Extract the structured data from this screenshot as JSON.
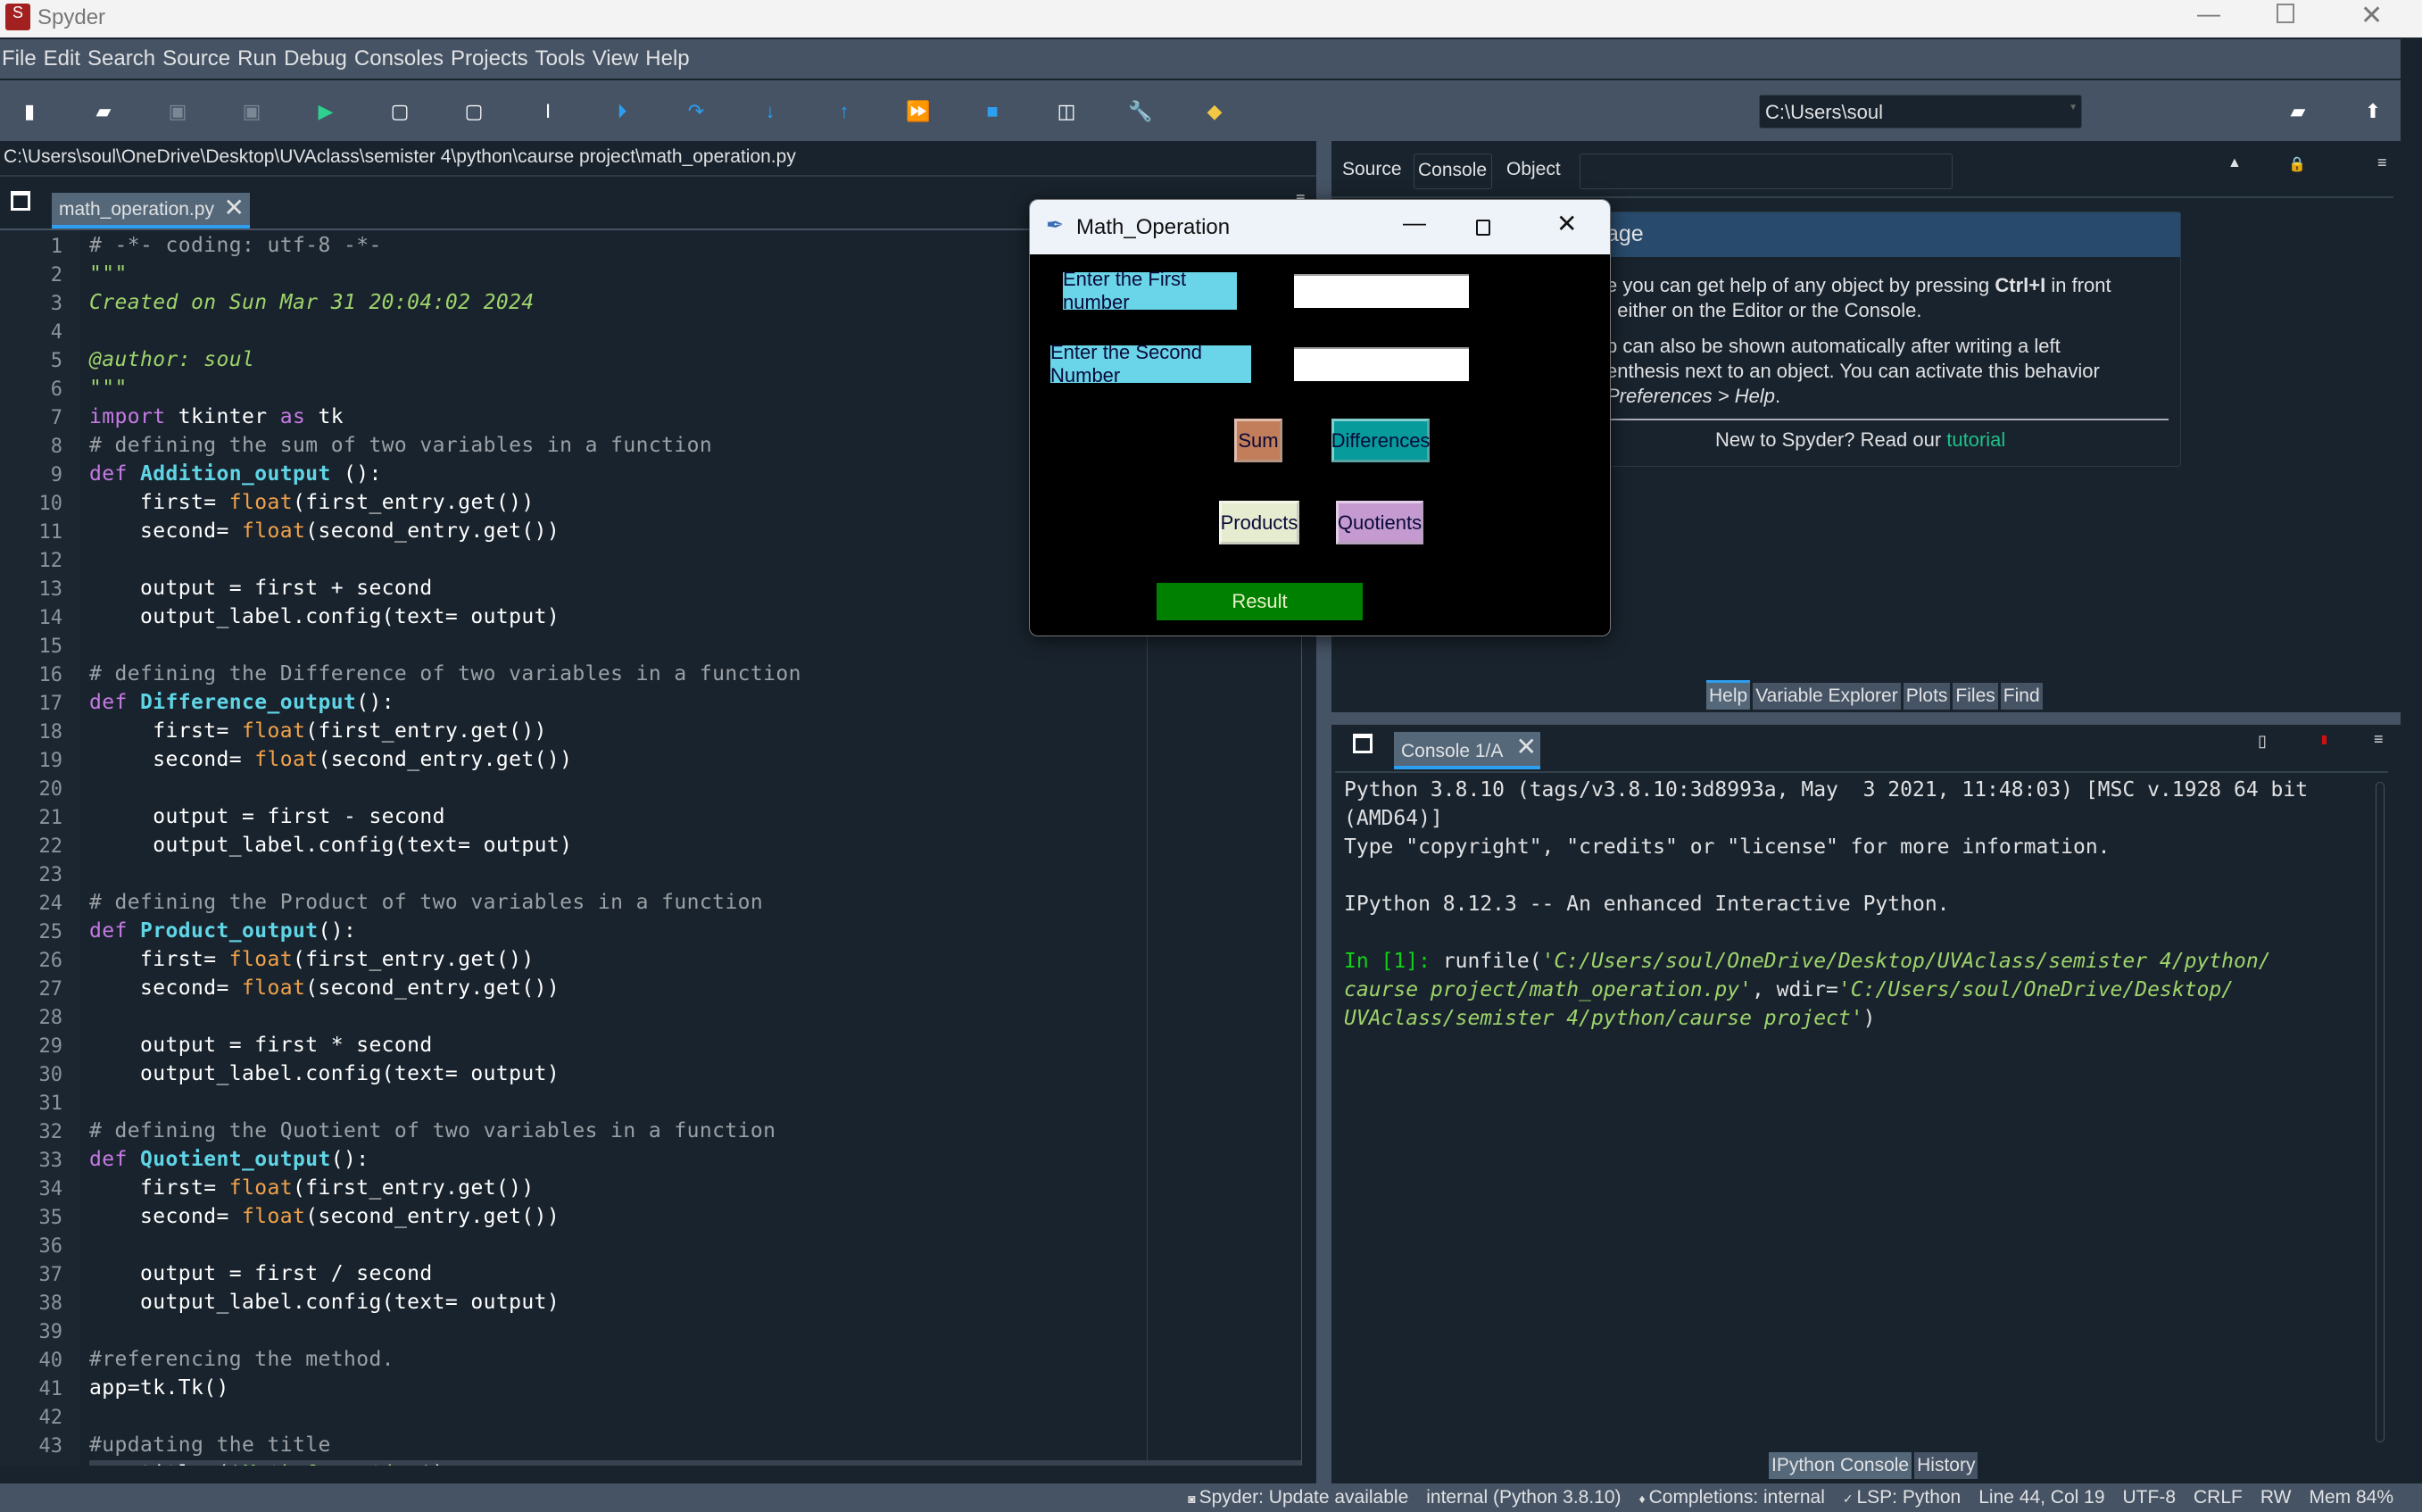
{
  "app": {
    "title": "Spyder"
  },
  "menu": [
    "File",
    "Edit",
    "Search",
    "Source",
    "Run",
    "Debug",
    "Consoles",
    "Projects",
    "Tools",
    "View",
    "Help"
  ],
  "toolbar": {
    "icons": [
      "new-file-icon",
      "open-file-icon",
      "save-icon",
      "save-all-icon",
      "run-icon",
      "run-cell-icon",
      "run-cell-advance-icon",
      "run-selection-icon",
      "debug-icon",
      "step-over-icon",
      "step-into-icon",
      "step-return-icon",
      "continue-icon",
      "stop-icon",
      "maximize-pane-icon",
      "preferences-wrench-icon",
      "python-path-icon"
    ],
    "working_dir": "C:\\Users\\soul"
  },
  "editor": {
    "path": "C:\\Users\\soul\\OneDrive\\Desktop\\UVAclass\\semister 4\\python\\caurse project\\math_operation.py",
    "tab": "math_operation.py",
    "current_line": 44,
    "lines": [
      [
        [
          "c",
          "# -*- coding: utf-8 -*-"
        ]
      ],
      [
        [
          "s",
          "\"\"\""
        ]
      ],
      [
        [
          "si",
          "Created on Sun Mar 31 20:04:02 2024"
        ]
      ],
      [],
      [
        [
          "si",
          "@author: soul"
        ]
      ],
      [
        [
          "s",
          "\"\"\""
        ]
      ],
      [
        [
          "k",
          "import"
        ],
        [
          "n",
          " tkinter "
        ],
        [
          "k",
          "as"
        ],
        [
          "n",
          " tk"
        ]
      ],
      [
        [
          "c",
          "# defining the sum of two variables in a function"
        ]
      ],
      [
        [
          "k",
          "def "
        ],
        [
          "f",
          "Addition_output"
        ],
        [
          "n",
          " ():"
        ]
      ],
      [
        [
          "n",
          "    first= "
        ],
        [
          "b",
          "float"
        ],
        [
          "n",
          "(first_entry.get())"
        ]
      ],
      [
        [
          "n",
          "    second= "
        ],
        [
          "b",
          "float"
        ],
        [
          "n",
          "(second_entry.get())"
        ]
      ],
      [],
      [
        [
          "n",
          "    output = first + second"
        ]
      ],
      [
        [
          "n",
          "    output_label.config(text= output)"
        ]
      ],
      [],
      [
        [
          "c",
          "# defining the Difference of two variables in a function"
        ]
      ],
      [
        [
          "k",
          "def "
        ],
        [
          "f",
          "Difference_output"
        ],
        [
          "n",
          "():"
        ]
      ],
      [
        [
          "n",
          "     first= "
        ],
        [
          "b",
          "float"
        ],
        [
          "n",
          "(first_entry.get())"
        ]
      ],
      [
        [
          "n",
          "     second= "
        ],
        [
          "b",
          "float"
        ],
        [
          "n",
          "(second_entry.get())"
        ]
      ],
      [],
      [
        [
          "n",
          "     output = first - second"
        ]
      ],
      [
        [
          "n",
          "     output_label.config(text= output)"
        ]
      ],
      [],
      [
        [
          "c",
          "# defining the Product of two variables in a function"
        ]
      ],
      [
        [
          "k",
          "def "
        ],
        [
          "f",
          "Product_output"
        ],
        [
          "n",
          "():"
        ]
      ],
      [
        [
          "n",
          "    first= "
        ],
        [
          "b",
          "float"
        ],
        [
          "n",
          "(first_entry.get())"
        ]
      ],
      [
        [
          "n",
          "    second= "
        ],
        [
          "b",
          "float"
        ],
        [
          "n",
          "(second_entry.get())"
        ]
      ],
      [],
      [
        [
          "n",
          "    output = first * second"
        ]
      ],
      [
        [
          "n",
          "    output_label.config(text= output)"
        ]
      ],
      [],
      [
        [
          "c",
          "# defining the Quotient of two variables in a function"
        ]
      ],
      [
        [
          "k",
          "def "
        ],
        [
          "f",
          "Quotient_output"
        ],
        [
          "n",
          "():"
        ]
      ],
      [
        [
          "n",
          "    first= "
        ],
        [
          "b",
          "float"
        ],
        [
          "n",
          "(first_entry.get())"
        ]
      ],
      [
        [
          "n",
          "    second= "
        ],
        [
          "b",
          "float"
        ],
        [
          "n",
          "(second_entry.get())"
        ]
      ],
      [],
      [
        [
          "n",
          "    output = first / second"
        ]
      ],
      [
        [
          "n",
          "    output_label.config(text= output)"
        ]
      ],
      [],
      [
        [
          "c",
          "#referencing the method."
        ]
      ],
      [
        [
          "n",
          "app=tk.Tk()"
        ]
      ],
      [],
      [
        [
          "c",
          "#updating the title"
        ]
      ],
      [
        [
          "n",
          "app.title ("
        ],
        [
          "si",
          "'Math_Operation'"
        ],
        [
          "n",
          ")"
        ]
      ]
    ]
  },
  "help": {
    "source_label": "Source",
    "source_value": "Console",
    "object_label": "Object",
    "object_value": "",
    "header": "age",
    "p1a": "e you can get help of any object by pressing ",
    "p1b": "Ctrl+I",
    "p1c": " in front",
    "p1d": ", either on the Editor or the Console.",
    "p2a": "p can also be shown automatically after writing a left",
    "p2b": "enthesis next to an object. You can activate this behavior",
    "p2c": "Preferences > Help",
    "p2d": ".",
    "footer": "New to Spyder? Read our ",
    "footer_link": "tutorial",
    "link_color": "#1fc08a",
    "tabs": [
      "Help",
      "Variable Explorer",
      "Plots",
      "Files",
      "Find"
    ],
    "active_tab": "Help"
  },
  "console": {
    "tab": "Console 1/A",
    "lines": [
      "Python 3.8.10 (tags/v3.8.10:3d8993a, May  3 2021, 11:48:03) [MSC v.1928 64 bit",
      "(AMD64)]",
      "Type \"copyright\", \"credits\" or \"license\" for more information.",
      "IPython 8.12.3 -- An enhanced Interactive Python."
    ],
    "prompt": "In [1]: ",
    "cmd": "runfile(",
    "arg1a": "'C:/Users/soul/OneDrive/Desktop/UVAclass/semister 4/python/",
    "arg1b": "caurse project/math_operation.py'",
    "wdir": ", wdir=",
    "arg2a": "'C:/Users/soul/OneDrive/Desktop/",
    "arg2b": "UVAclass/semister 4/python/caurse project'",
    "close": ")",
    "bottom_tabs": [
      "IPython Console",
      "History"
    ],
    "active_tab": "IPython Console"
  },
  "tk_window": {
    "title": "Math_Operation",
    "label_first": "Enter the First number",
    "first_value": "",
    "label_second": "Enter the Second Number",
    "second_value": "",
    "sum": "Sum",
    "differences": "Differences",
    "products": "Products",
    "quotients": "Quotients",
    "result": "Result",
    "colors": {
      "label": "#6ad4e8",
      "sum": "#c27d5a",
      "differences": "#079b9b",
      "products": "#e6ecd0",
      "quotients": "#c59ad0",
      "result": "#008000"
    }
  },
  "status": [
    "Spyder: Update available",
    "internal (Python 3.8.10)",
    "Completions: internal",
    "LSP: Python",
    "Line 44, Col 19",
    "UTF-8",
    "CRLF",
    "RW",
    "Mem 84%"
  ]
}
